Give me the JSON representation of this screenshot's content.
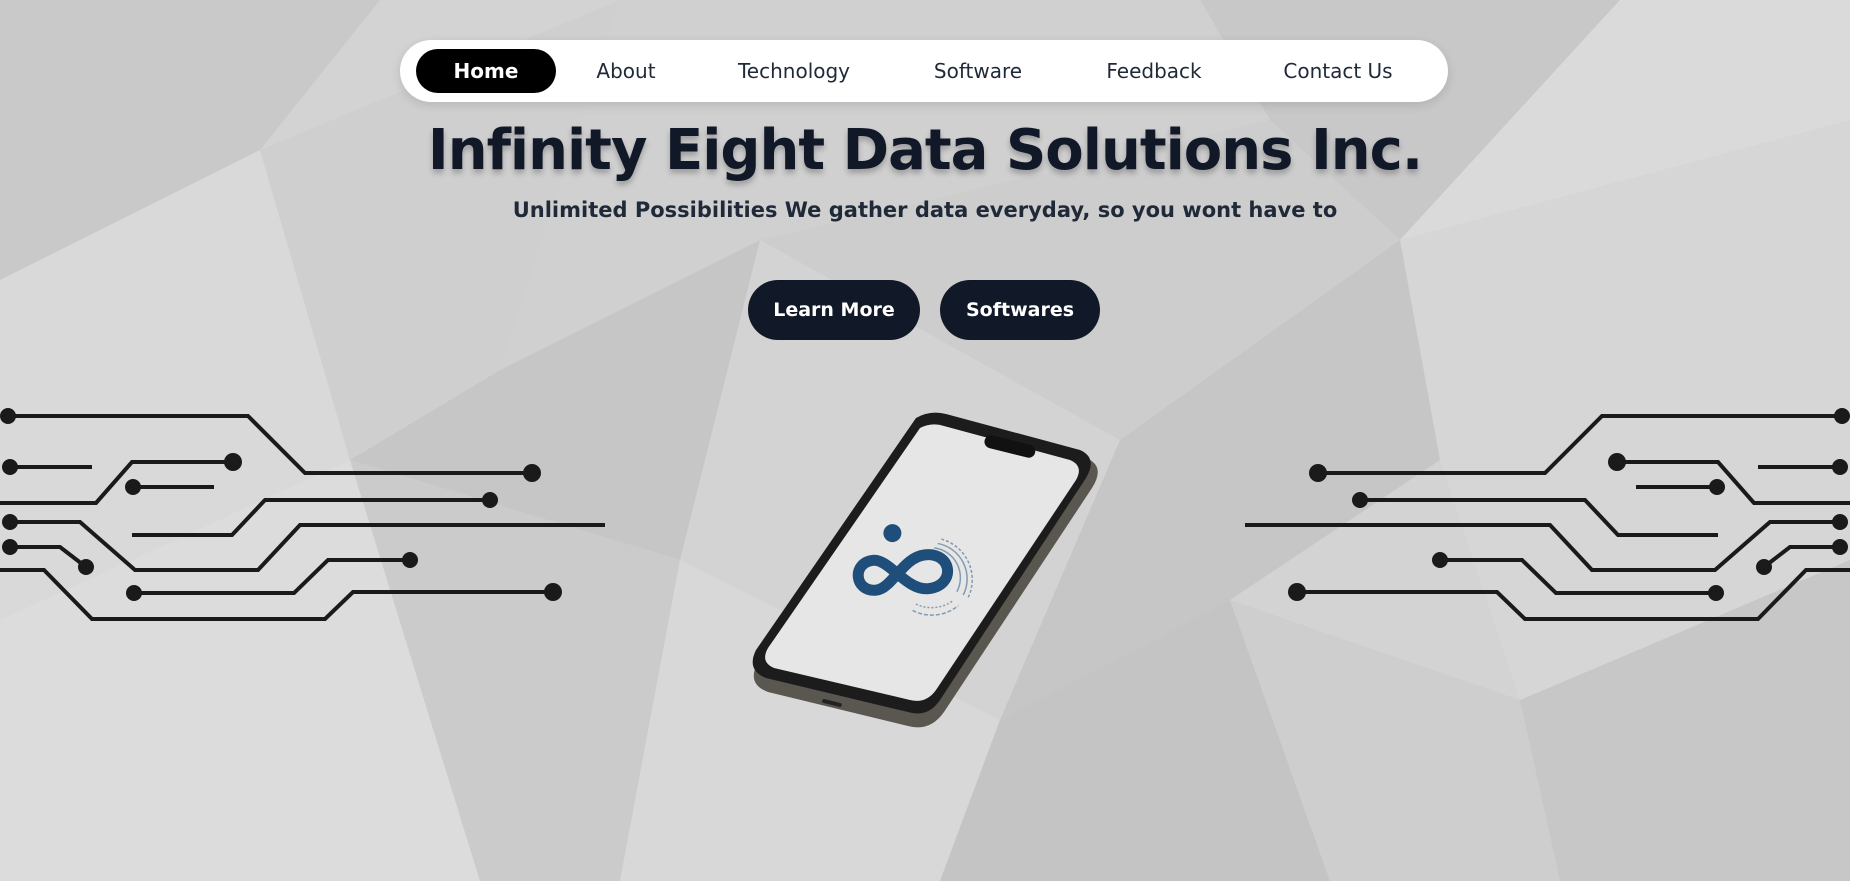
{
  "nav": {
    "items": [
      {
        "label": "Home",
        "active": true
      },
      {
        "label": "About",
        "active": false
      },
      {
        "label": "Technology",
        "active": false
      },
      {
        "label": "Software",
        "active": false
      },
      {
        "label": "Feedback",
        "active": false
      },
      {
        "label": "Contact Us",
        "active": false
      }
    ]
  },
  "hero": {
    "title": "Infinity Eight Data Solutions Inc.",
    "subtitle": "Unlimited Possibilities We gather data everyday, so you wont have to",
    "buttons": {
      "learn_more": "Learn More",
      "softwares": "Softwares"
    }
  },
  "colors": {
    "background": "#d4d4d4",
    "primary_dark": "#111827",
    "nav_active": "#000000",
    "logo_blue": "#1f4e7a",
    "circuit": "#1a1a1a"
  },
  "icons": {
    "phone": "smartphone-icon",
    "logo": "infinity-logo-icon",
    "circuits": "circuit-lines-icon"
  }
}
